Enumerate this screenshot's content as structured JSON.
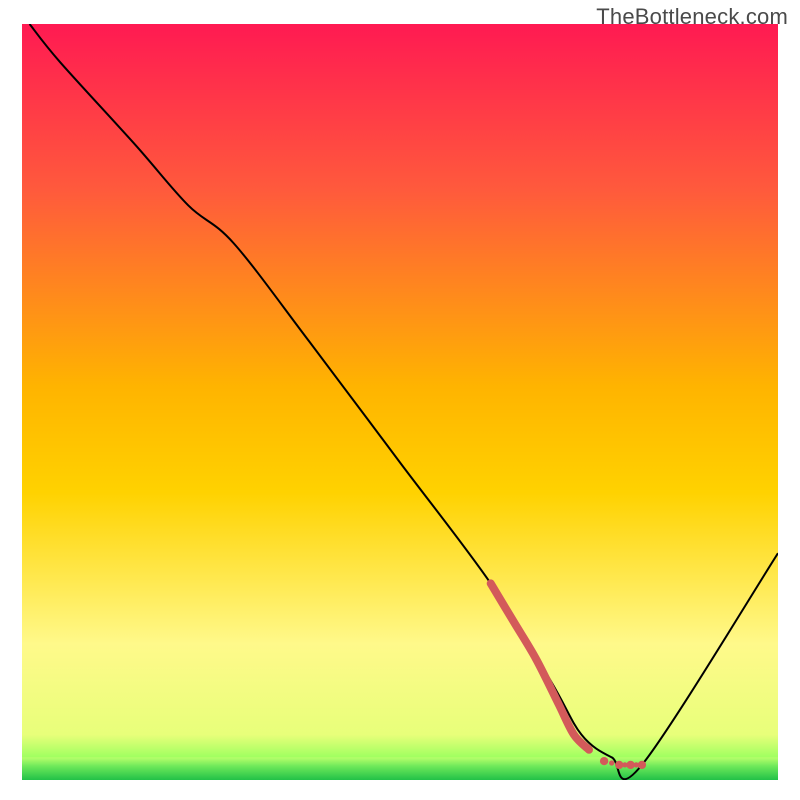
{
  "watermark": "TheBottleneck.com",
  "chart_data": {
    "type": "line",
    "xlim": [
      0,
      100
    ],
    "ylim": [
      0,
      100
    ],
    "xlabel": "",
    "ylabel": "",
    "title": "",
    "grid": false,
    "series": [
      {
        "name": "bottleneck-curve",
        "x": [
          1,
          5,
          15,
          22,
          28,
          38,
          50,
          62,
          70,
          74,
          78,
          82,
          100
        ],
        "y": [
          100,
          95,
          84,
          76,
          71,
          58,
          42,
          26,
          13,
          6,
          3,
          2,
          30
        ],
        "stroke": "#000000",
        "width": 2
      },
      {
        "name": "highlight-dashed",
        "x": [
          62,
          65,
          68,
          71,
          73,
          75,
          77,
          79,
          80.5,
          82
        ],
        "y": [
          26,
          21,
          16,
          10,
          6,
          4,
          2.5,
          2,
          2,
          2
        ],
        "stroke": "#d35a5a",
        "width": 8,
        "dash": "solid-then-dots"
      }
    ],
    "background_gradient": {
      "top": "#ff1a52",
      "mid": "#ffd200",
      "lower": "#fff98a",
      "bottom": "#2ecc40"
    }
  }
}
